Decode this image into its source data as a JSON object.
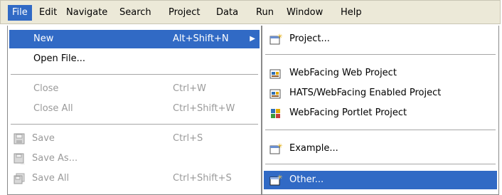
{
  "menubar": {
    "items": [
      "File",
      "Edit",
      "Navigate",
      "Search",
      "Project",
      "Data",
      "Run",
      "Window",
      "Help"
    ]
  },
  "file_menu": {
    "new_label": "New",
    "new_shortcut": "Alt+Shift+N",
    "open_file_label": "Open File...",
    "close_label": "Close",
    "close_shortcut": "Ctrl+W",
    "close_all_label": "Close All",
    "close_all_shortcut": "Ctrl+Shift+W",
    "save_label": "Save",
    "save_shortcut": "Ctrl+S",
    "save_as_label": "Save As...",
    "save_all_label": "Save All",
    "save_all_shortcut": "Ctrl+Shift+S"
  },
  "new_submenu": {
    "project_label": "Project...",
    "webfacing_web_project_label": "WebFacing Web Project",
    "hats_webfacing_label": "HATS/WebFacing Enabled Project",
    "webfacing_portlet_label": "WebFacing Portlet Project",
    "example_label": "Example...",
    "other_label": "Other..."
  },
  "colors": {
    "selection": "#316ac5",
    "menubar_bg": "#ece9d8",
    "disabled_text": "#9a9a9a"
  }
}
